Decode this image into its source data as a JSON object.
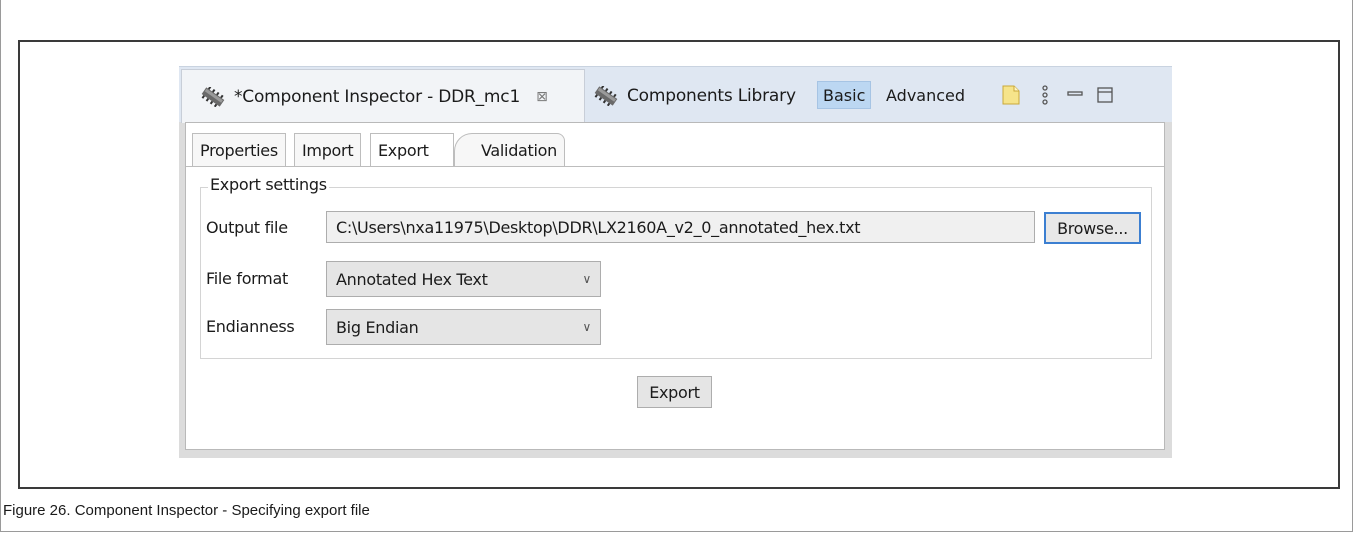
{
  "view": {
    "active_tab": "*Component Inspector - DDR_mc1",
    "close_glyph": "⊠",
    "other_tab": "Components Library",
    "mode_basic": "Basic",
    "mode_advanced": "Advanced",
    "icons": [
      "components-icon",
      "new-note-icon",
      "view-menu-icon",
      "minimize-icon",
      "maximize-icon"
    ]
  },
  "subtabs": [
    "Properties",
    "Import",
    "Export",
    "Validation"
  ],
  "export_settings": {
    "group_label": "Export settings",
    "output_file_label": "Output file",
    "output_file_value": "C:\\Users\\nxa11975\\Desktop\\DDR\\LX2160A_v2_0_annotated_hex.txt",
    "browse_label": "Browse...",
    "file_format_label": "File format",
    "file_format_value": "Annotated Hex Text",
    "endianness_label": "Endianness",
    "endianness_value": "Big Endian",
    "export_label": "Export"
  },
  "caption": "Figure 26. Component Inspector - Specifying export file",
  "colors": {
    "tab_bar_bg": "#dfe7f2",
    "basic_selected_bg": "#bcd7f2",
    "focus_border": "#3c7fd1"
  }
}
